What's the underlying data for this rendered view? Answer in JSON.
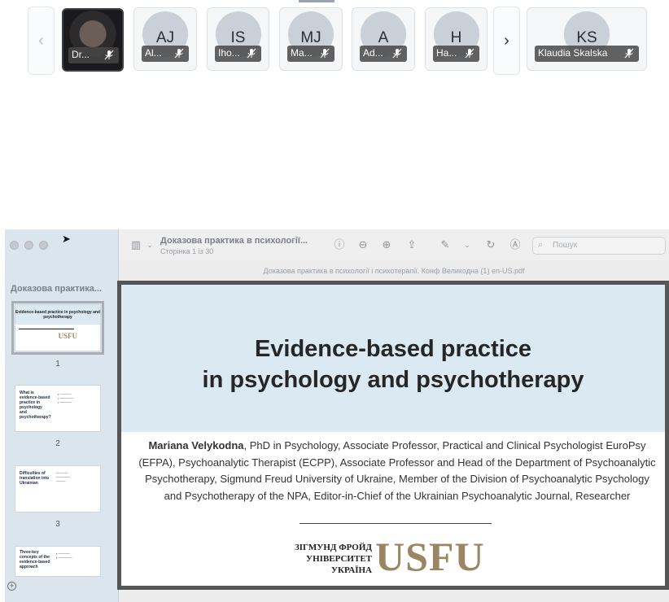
{
  "participants": [
    {
      "label": "Dr...",
      "muted": true
    },
    {
      "initials": "AJ",
      "label": "Al...",
      "muted": true
    },
    {
      "initials": "IS",
      "label": "Iho...",
      "muted": true
    },
    {
      "initials": "MJ",
      "label": "Ma...",
      "muted": true
    },
    {
      "initials": "A",
      "label": "Ad...",
      "muted": true
    },
    {
      "initials": "H",
      "label": "Ha...",
      "muted": true
    },
    {
      "initials": "KS",
      "label": "Klaudia Skalska",
      "muted": true
    }
  ],
  "strip_nav": {
    "prev": "‹",
    "next": "›"
  },
  "viewer": {
    "sidebar_title": "Доказова практика...",
    "thumbnails": [
      {
        "page": "1",
        "title": "Evidence-based practice in psychology and psychotherapy",
        "logo": "USFU"
      },
      {
        "page": "2",
        "title": "What is evidence-based practice in psychology and psychotherapy?"
      },
      {
        "page": "3",
        "title": "Difficulties of translation into Ukrainian"
      },
      {
        "page": "",
        "title": "Three-key concepts of the evidence-based approach"
      }
    ],
    "doc_title": "Доказова практика в психології...",
    "doc_subtitle": "Сторінка 1 із 30",
    "search_placeholder": "Пошук",
    "file_name": "Доказова практика в психології і психотерапії. Конф Великодна (1) en-US.pdf"
  },
  "slide": {
    "title_line1": "Evidence-based practice",
    "title_line2": "in psychology and psychotherapy",
    "author_name": "Mariana Velykodna",
    "author_details": ", PhD in Psychology, Associate Professor, Practical and Clinical Psychologist EuroPsy (EFPA), Psychoanalytic Therapist (ECPP), Associate Professor and Head of the Department of Psychoanalytic Psychotherapy, Sigmund Freud University of Ukraine, Member of the Division of Psychoanalytic Psychology and Psychotherapy of the NPA, Editor-in-Chief of the Ukrainian Psychoanalytic Journal, Researcher",
    "logo_small_line1": "ЗІГМУНД ФРОЙД",
    "logo_small_line2": "УНІВЕРСИТЕТ",
    "logo_small_line3": "УКРАЇНА",
    "logo_big": "USFU"
  },
  "colors": {
    "slide_header_bg": "#dbeaf2",
    "logo_gold": "#9c8563",
    "sidebar_bg": "#dbe5ed"
  }
}
